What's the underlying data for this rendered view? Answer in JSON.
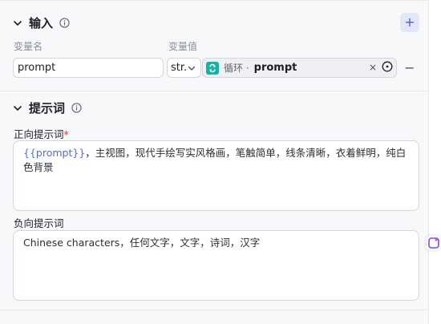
{
  "inputs_section": {
    "title": "输入",
    "add_label": "+",
    "col_name": "变量名",
    "col_value": "变量值",
    "row": {
      "name_value": "prompt",
      "type_label": "str.",
      "ref_source": "循环 ·",
      "ref_value": "prompt",
      "clear_label": "×",
      "remove_label": "−"
    }
  },
  "prompt_section": {
    "title": "提示词",
    "positive_label": "正向提示词",
    "required_mark": "*",
    "positive_var": "{{prompt}}",
    "positive_text": "，主视图，现代手绘写实风格画，笔触简单，线条清晰，衣着鲜明，纯白色背景",
    "negative_label": "负向提示词",
    "negative_text": "Chinese characters，任何文字，文字，诗词，汉字"
  },
  "colors": {
    "accent": "#4b5bdc",
    "loop_icon": "#16b2a5",
    "required": "#e0343b",
    "token": "#5a6ad6"
  },
  "icons": [
    "chevron-down-icon",
    "info-icon",
    "plus-icon",
    "loop-icon",
    "target-icon",
    "minus-icon",
    "sparkle-icon"
  ]
}
